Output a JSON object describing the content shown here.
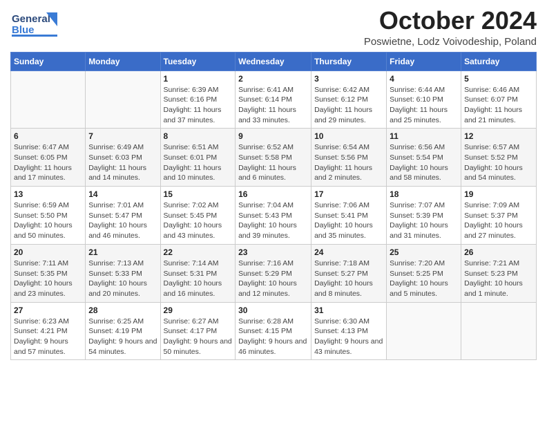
{
  "header": {
    "logo_line1": "General",
    "logo_line2": "Blue",
    "month": "October 2024",
    "location": "Poswietne, Lodz Voivodeship, Poland"
  },
  "weekdays": [
    "Sunday",
    "Monday",
    "Tuesday",
    "Wednesday",
    "Thursday",
    "Friday",
    "Saturday"
  ],
  "weeks": [
    [
      {
        "day": "",
        "info": ""
      },
      {
        "day": "",
        "info": ""
      },
      {
        "day": "1",
        "info": "Sunrise: 6:39 AM\nSunset: 6:16 PM\nDaylight: 11 hours and 37 minutes."
      },
      {
        "day": "2",
        "info": "Sunrise: 6:41 AM\nSunset: 6:14 PM\nDaylight: 11 hours and 33 minutes."
      },
      {
        "day": "3",
        "info": "Sunrise: 6:42 AM\nSunset: 6:12 PM\nDaylight: 11 hours and 29 minutes."
      },
      {
        "day": "4",
        "info": "Sunrise: 6:44 AM\nSunset: 6:10 PM\nDaylight: 11 hours and 25 minutes."
      },
      {
        "day": "5",
        "info": "Sunrise: 6:46 AM\nSunset: 6:07 PM\nDaylight: 11 hours and 21 minutes."
      }
    ],
    [
      {
        "day": "6",
        "info": "Sunrise: 6:47 AM\nSunset: 6:05 PM\nDaylight: 11 hours and 17 minutes."
      },
      {
        "day": "7",
        "info": "Sunrise: 6:49 AM\nSunset: 6:03 PM\nDaylight: 11 hours and 14 minutes."
      },
      {
        "day": "8",
        "info": "Sunrise: 6:51 AM\nSunset: 6:01 PM\nDaylight: 11 hours and 10 minutes."
      },
      {
        "day": "9",
        "info": "Sunrise: 6:52 AM\nSunset: 5:58 PM\nDaylight: 11 hours and 6 minutes."
      },
      {
        "day": "10",
        "info": "Sunrise: 6:54 AM\nSunset: 5:56 PM\nDaylight: 11 hours and 2 minutes."
      },
      {
        "day": "11",
        "info": "Sunrise: 6:56 AM\nSunset: 5:54 PM\nDaylight: 10 hours and 58 minutes."
      },
      {
        "day": "12",
        "info": "Sunrise: 6:57 AM\nSunset: 5:52 PM\nDaylight: 10 hours and 54 minutes."
      }
    ],
    [
      {
        "day": "13",
        "info": "Sunrise: 6:59 AM\nSunset: 5:50 PM\nDaylight: 10 hours and 50 minutes."
      },
      {
        "day": "14",
        "info": "Sunrise: 7:01 AM\nSunset: 5:47 PM\nDaylight: 10 hours and 46 minutes."
      },
      {
        "day": "15",
        "info": "Sunrise: 7:02 AM\nSunset: 5:45 PM\nDaylight: 10 hours and 43 minutes."
      },
      {
        "day": "16",
        "info": "Sunrise: 7:04 AM\nSunset: 5:43 PM\nDaylight: 10 hours and 39 minutes."
      },
      {
        "day": "17",
        "info": "Sunrise: 7:06 AM\nSunset: 5:41 PM\nDaylight: 10 hours and 35 minutes."
      },
      {
        "day": "18",
        "info": "Sunrise: 7:07 AM\nSunset: 5:39 PM\nDaylight: 10 hours and 31 minutes."
      },
      {
        "day": "19",
        "info": "Sunrise: 7:09 AM\nSunset: 5:37 PM\nDaylight: 10 hours and 27 minutes."
      }
    ],
    [
      {
        "day": "20",
        "info": "Sunrise: 7:11 AM\nSunset: 5:35 PM\nDaylight: 10 hours and 23 minutes."
      },
      {
        "day": "21",
        "info": "Sunrise: 7:13 AM\nSunset: 5:33 PM\nDaylight: 10 hours and 20 minutes."
      },
      {
        "day": "22",
        "info": "Sunrise: 7:14 AM\nSunset: 5:31 PM\nDaylight: 10 hours and 16 minutes."
      },
      {
        "day": "23",
        "info": "Sunrise: 7:16 AM\nSunset: 5:29 PM\nDaylight: 10 hours and 12 minutes."
      },
      {
        "day": "24",
        "info": "Sunrise: 7:18 AM\nSunset: 5:27 PM\nDaylight: 10 hours and 8 minutes."
      },
      {
        "day": "25",
        "info": "Sunrise: 7:20 AM\nSunset: 5:25 PM\nDaylight: 10 hours and 5 minutes."
      },
      {
        "day": "26",
        "info": "Sunrise: 7:21 AM\nSunset: 5:23 PM\nDaylight: 10 hours and 1 minute."
      }
    ],
    [
      {
        "day": "27",
        "info": "Sunrise: 6:23 AM\nSunset: 4:21 PM\nDaylight: 9 hours and 57 minutes."
      },
      {
        "day": "28",
        "info": "Sunrise: 6:25 AM\nSunset: 4:19 PM\nDaylight: 9 hours and 54 minutes."
      },
      {
        "day": "29",
        "info": "Sunrise: 6:27 AM\nSunset: 4:17 PM\nDaylight: 9 hours and 50 minutes."
      },
      {
        "day": "30",
        "info": "Sunrise: 6:28 AM\nSunset: 4:15 PM\nDaylight: 9 hours and 46 minutes."
      },
      {
        "day": "31",
        "info": "Sunrise: 6:30 AM\nSunset: 4:13 PM\nDaylight: 9 hours and 43 minutes."
      },
      {
        "day": "",
        "info": ""
      },
      {
        "day": "",
        "info": ""
      }
    ]
  ]
}
